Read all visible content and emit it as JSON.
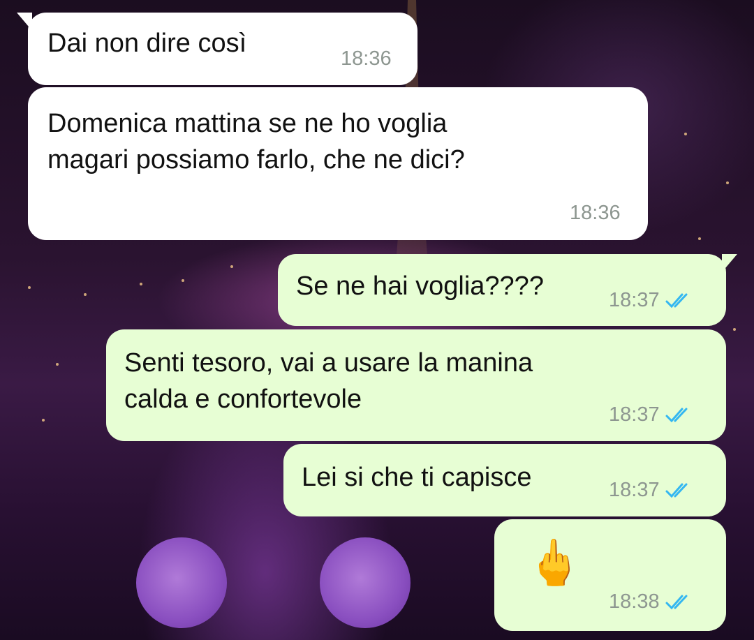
{
  "theme": {
    "incoming_bubble": "#ffffff",
    "outgoing_bubble": "#e7fed4",
    "timestamp_color": "#8d9690",
    "read_check_color": "#34b7f1"
  },
  "messages": [
    {
      "direction": "incoming",
      "text": "Dai non dire così",
      "time": "18:36"
    },
    {
      "direction": "incoming",
      "text": "Domenica mattina se ne ho voglia\nmagari possiamo farlo, che ne dici?",
      "time": "18:36"
    },
    {
      "direction": "outgoing",
      "text": "Se ne hai voglia????",
      "time": "18:37",
      "status": "read"
    },
    {
      "direction": "outgoing",
      "text": "Senti tesoro, vai a usare la manina\ncalda e confortevole",
      "time": "18:37",
      "status": "read"
    },
    {
      "direction": "outgoing",
      "text": "Lei si che ti capisce",
      "time": "18:37",
      "status": "read"
    },
    {
      "direction": "outgoing",
      "text": "🖕",
      "time": "18:38",
      "status": "read"
    }
  ]
}
